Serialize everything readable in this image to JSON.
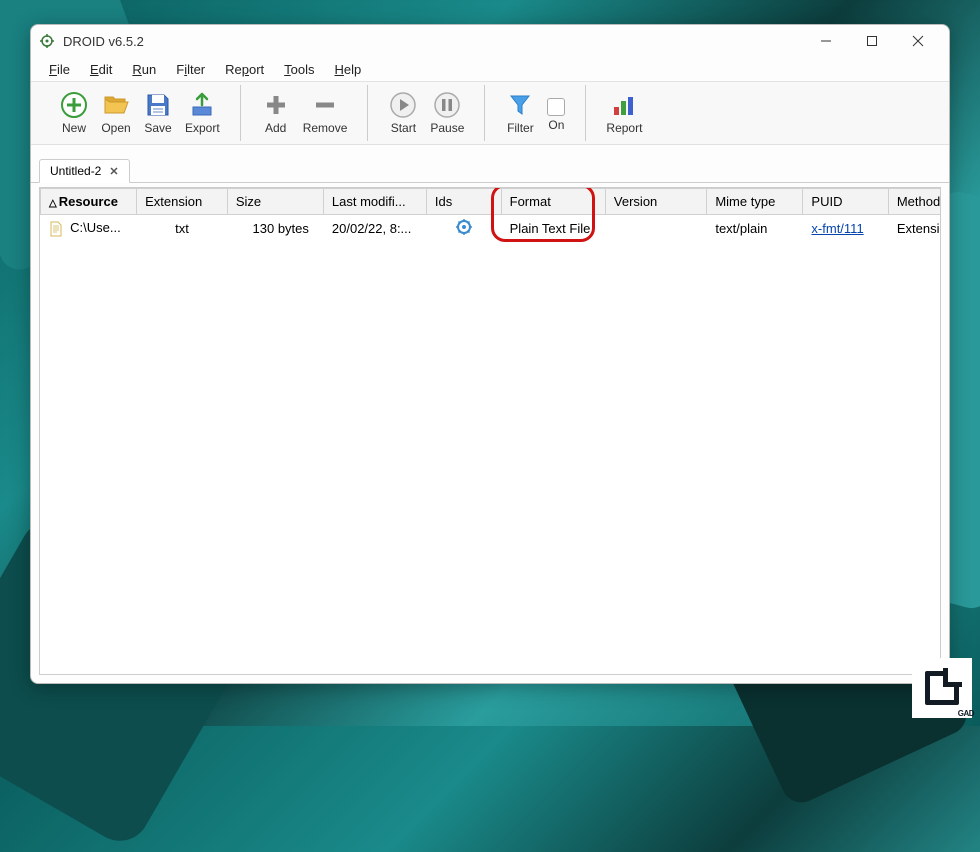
{
  "window": {
    "title": "DROID v6.5.2"
  },
  "menu": {
    "file": "File",
    "edit": "Edit",
    "run": "Run",
    "filter": "Filter",
    "report": "Report",
    "tools": "Tools",
    "help": "Help"
  },
  "toolbar": {
    "new": "New",
    "open": "Open",
    "save": "Save",
    "export": "Export",
    "add": "Add",
    "remove": "Remove",
    "start": "Start",
    "pause": "Pause",
    "filter": "Filter",
    "on": "On",
    "report": "Report"
  },
  "tabs": [
    {
      "label": "Untitled-2"
    }
  ],
  "columns": {
    "resource": "Resource",
    "extension": "Extension",
    "size": "Size",
    "last_modified": "Last modifi...",
    "ids": "Ids",
    "format": "Format",
    "version": "Version",
    "mime_type": "Mime type",
    "puid": "PUID",
    "method": "Method"
  },
  "rows": [
    {
      "resource": "C:\\Use...",
      "extension": "txt",
      "size": "130 bytes",
      "last_modified": "20/02/22, 8:...",
      "ids": "gear",
      "format": "Plain Text File",
      "version": "",
      "mime_type": "text/plain",
      "puid": "x-fmt/111",
      "method": "Extension"
    }
  ],
  "watermark": "GAD"
}
